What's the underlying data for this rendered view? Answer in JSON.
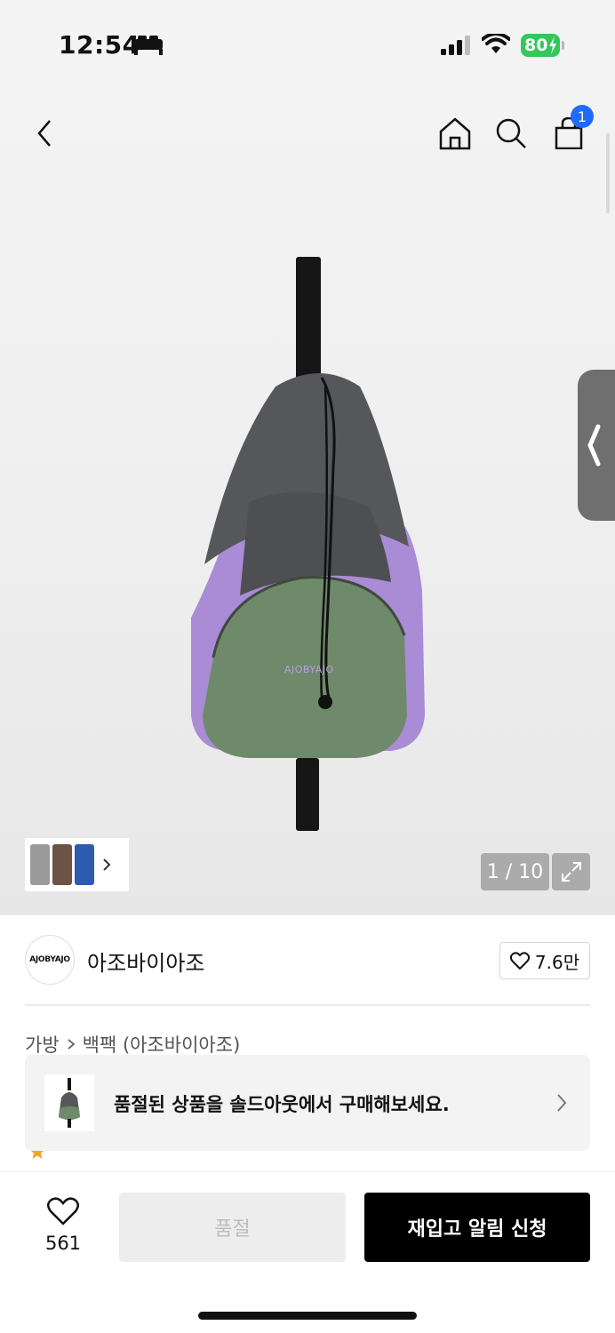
{
  "status_bar": {
    "time": "12:54",
    "battery_level": "80",
    "icons": [
      "bed-icon",
      "signal-icon",
      "wifi-icon",
      "battery-charging-icon"
    ]
  },
  "nav": {
    "icons": [
      "back-chevron-icon",
      "home-icon",
      "search-icon",
      "shopping-bag-icon"
    ],
    "cart_count": "1"
  },
  "gallery": {
    "logo_text": "AJOBYAJO",
    "counter": "1 / 10",
    "current_index": 1,
    "total_images": 10,
    "colors": {
      "bag_dark": "#56575a",
      "bag_purple": "#a98bd6",
      "bag_green": "#6f8a6a",
      "strap": "#161616"
    }
  },
  "brand": {
    "logo_text": "AJOBYAJO",
    "name": "아조바이아조",
    "likes": "7.6만"
  },
  "breadcrumb": {
    "category": "가방",
    "subcategory": "백팩 (아조바이아조)"
  },
  "soldout_banner": {
    "text": "품절된 상품을 솔드아웃에서 구매해보세요."
  },
  "bottom_bar": {
    "like_count": "561",
    "soldout_label": "품절",
    "restock_label": "재입고 알림 신청"
  },
  "colors": {
    "accent_blue": "#1f6bff",
    "battery_green": "#34c759",
    "primary_button": "#000000",
    "disabled_button": "#ededed"
  }
}
